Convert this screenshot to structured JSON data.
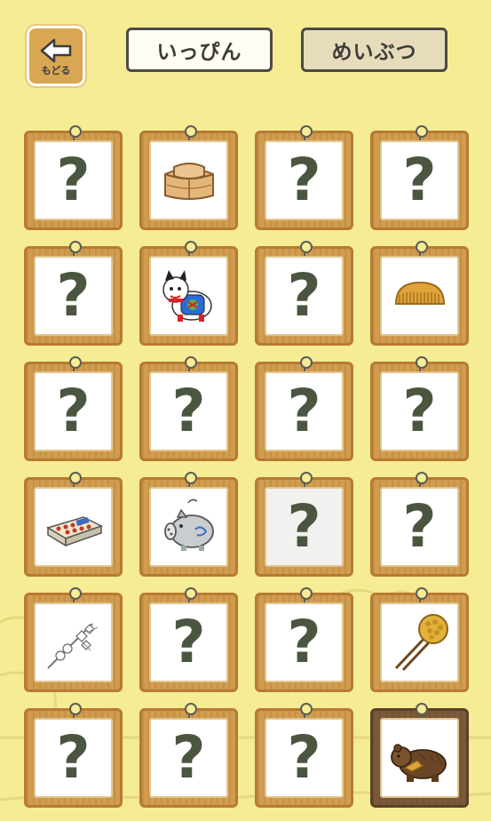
{
  "back_button": {
    "label": "もどる",
    "icon": "left-arrow-icon"
  },
  "tabs": [
    {
      "label": "いっぴん",
      "selected": true
    },
    {
      "label": "めいぶつ",
      "selected": false
    }
  ],
  "unknown_mark": "?",
  "colors": {
    "background": "#f5ec94",
    "frame_wood": "#d29c4e",
    "frame_dark": "#7a5a3a",
    "question_mark": "#4b5641"
  },
  "items": [
    {
      "state": "unknown"
    },
    {
      "state": "found",
      "icon": "wooden-bento-box-icon"
    },
    {
      "state": "unknown"
    },
    {
      "state": "unknown"
    },
    {
      "state": "unknown"
    },
    {
      "state": "found",
      "icon": "inu-hariko-dog-icon"
    },
    {
      "state": "unknown"
    },
    {
      "state": "found",
      "icon": "wooden-comb-icon"
    },
    {
      "state": "unknown"
    },
    {
      "state": "unknown"
    },
    {
      "state": "unknown"
    },
    {
      "state": "unknown"
    },
    {
      "state": "found",
      "icon": "matchbox-icon"
    },
    {
      "state": "found",
      "icon": "pig-mosquito-coil-holder-icon"
    },
    {
      "state": "unknown",
      "dim": true
    },
    {
      "state": "unknown"
    },
    {
      "state": "found",
      "icon": "hair-ornament-kanzashi-icon"
    },
    {
      "state": "unknown"
    },
    {
      "state": "unknown"
    },
    {
      "state": "found",
      "icon": "tortoiseshell-hairpin-icon"
    },
    {
      "state": "unknown"
    },
    {
      "state": "unknown"
    },
    {
      "state": "unknown"
    },
    {
      "state": "found",
      "icon": "carved-bear-icon",
      "highlight": true
    }
  ]
}
